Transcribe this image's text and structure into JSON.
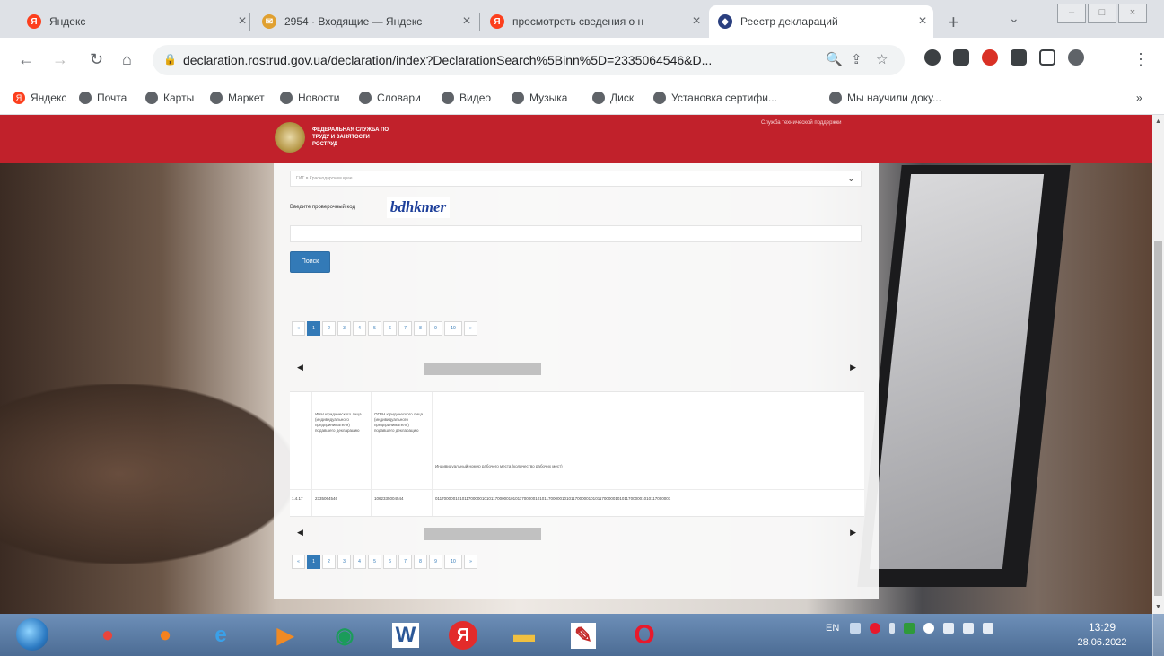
{
  "browser": {
    "tabs": [
      {
        "title": "Яндекс",
        "icon": "yandex-icon",
        "color": "#fc3f1d",
        "glyph": "Я"
      },
      {
        "title": "2954 · Входящие — Яндекс",
        "icon": "mail-icon",
        "color": "#e0a030",
        "glyph": "✉"
      },
      {
        "title": "просмотреть сведения о н",
        "icon": "yandex-icon",
        "color": "#fc3f1d",
        "glyph": "Я"
      },
      {
        "title": "Реестр деклараций",
        "icon": "shield-icon",
        "color": "#2a3f7f",
        "glyph": "◆"
      }
    ],
    "url": "declaration.rostrud.gov.ua/declaration/index?DeclarationSearch%5Binn%5D=2335064546&D...",
    "bookmarks": [
      "Яндекс",
      "Почта",
      "Карты",
      "Маркет",
      "Новости",
      "Словари",
      "Видео",
      "Музыка",
      "Диск",
      "Установка сертифи...",
      "Мы научили доку..."
    ],
    "bookmarks_more": "»"
  },
  "site": {
    "header_text": "ФЕДЕРАЛЬНАЯ СЛУЖБА ПО ТРУДУ И ЗАНЯТОСТИ РОСТРУД",
    "support_link": "Служба технической поддержки"
  },
  "form": {
    "select_value": "ГИТ в Краснодарском крае",
    "captcha_label": "Введите проверочный код",
    "captcha_text": "bdhkmer",
    "search_button": "Поиск"
  },
  "pagination": {
    "prev": "«",
    "pages": [
      "1",
      "2",
      "3",
      "4",
      "5",
      "6",
      "7",
      "8",
      "9",
      "10"
    ],
    "next": "»",
    "current": "1"
  },
  "table": {
    "headers": [
      "",
      "ИНН юридического лица (индивидуального предпринимателя) подавшего декларацию",
      "ОГРН юридического лица (индивидуального предпринимателя) подавшего декларацию",
      "Индивидуальный номер рабочего места (количество рабочих мест)"
    ],
    "row": [
      "1.4.17",
      "2335064546",
      "1062335004544",
      "0117000001010117000001010117000001010117000001010117000001010117000001010117000001010117000001010117000001"
    ]
  },
  "taskbar": {
    "apps": [
      {
        "name": "chrome",
        "glyph": "●",
        "color": "#e8453c"
      },
      {
        "name": "firefox",
        "glyph": "●",
        "color": "#f5821f"
      },
      {
        "name": "ie",
        "glyph": "e",
        "color": "#3aa0e8"
      },
      {
        "name": "media",
        "glyph": "▶",
        "color": "#f08a24"
      },
      {
        "name": "app",
        "glyph": "◉",
        "color": "#1b9c5a"
      },
      {
        "name": "word",
        "glyph": "W",
        "color": "#2b5797"
      },
      {
        "name": "yandex",
        "glyph": "Я",
        "color": "#e32b2b"
      },
      {
        "name": "folder",
        "glyph": "▬",
        "color": "#f0c040"
      },
      {
        "name": "pdf",
        "glyph": "✎",
        "color": "#c42b2b"
      },
      {
        "name": "opera",
        "glyph": "O",
        "color": "#e8192c"
      }
    ],
    "lang": "EN",
    "time": "13:29",
    "date": "28.06.2022"
  }
}
